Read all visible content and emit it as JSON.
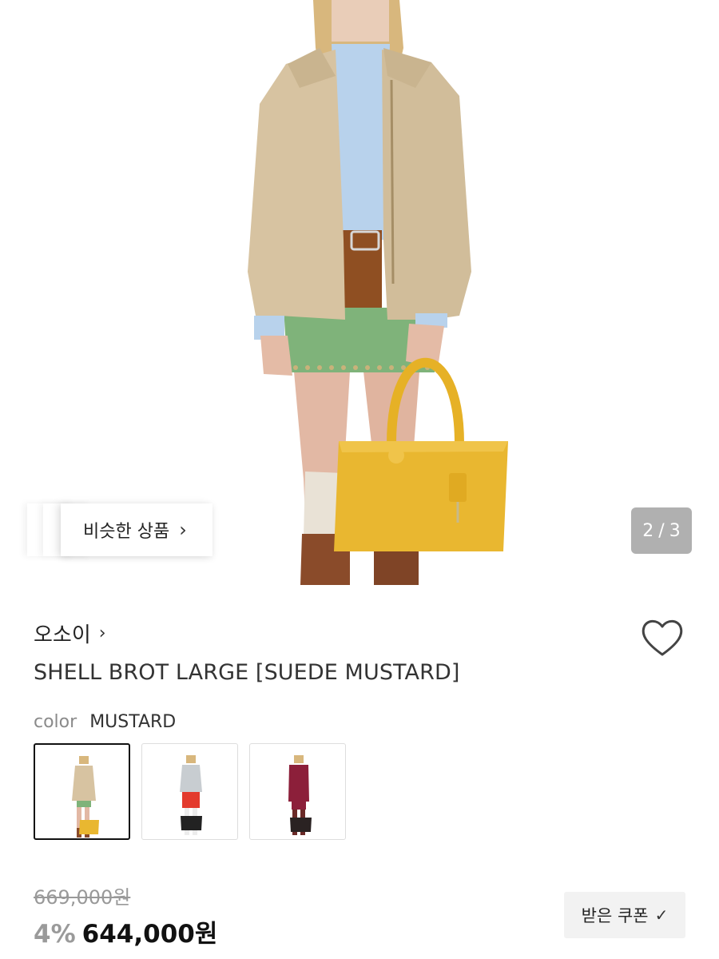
{
  "gallery": {
    "similar_label": "비슷한 상품",
    "similar_chevron": "›",
    "page_current": "2",
    "page_separator": "/",
    "page_total": "3"
  },
  "product": {
    "brand": "오소이",
    "brand_chevron": "›",
    "title": "SHELL BROT LARGE [SUEDE MUSTARD]",
    "color_label": "color",
    "color_value": "MUSTARD",
    "swatches": [
      "mustard",
      "black-red",
      "black-burgundy"
    ],
    "price_original": "669,000원",
    "discount": "4%",
    "price_final": "644,000원",
    "coupon_label": "받은 쿠폰",
    "coupon_check": "✓"
  },
  "colors": {
    "mustard": "#e9b730",
    "jacket": "#d7c3a1",
    "skirt": "#7fb37a",
    "boots": "#8a4b2a",
    "counter_bg": "#9a9a9a"
  },
  "icons": {
    "heart": "heart-outline-icon",
    "chevron": "chevron-right-icon",
    "check": "check-icon"
  }
}
